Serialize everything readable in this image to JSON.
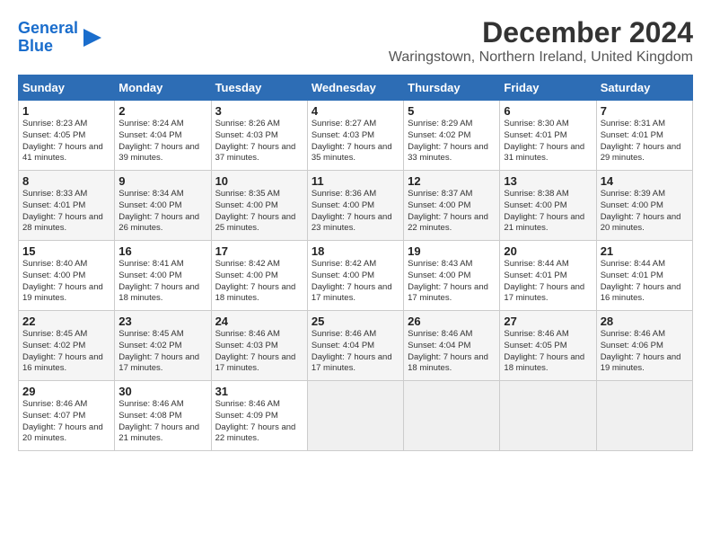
{
  "logo": {
    "line1": "General",
    "line2": "Blue"
  },
  "title": "December 2024",
  "subtitle": "Waringstown, Northern Ireland, United Kingdom",
  "days_of_week": [
    "Sunday",
    "Monday",
    "Tuesday",
    "Wednesday",
    "Thursday",
    "Friday",
    "Saturday"
  ],
  "weeks": [
    [
      {
        "day": "1",
        "info": "Sunrise: 8:23 AM\nSunset: 4:05 PM\nDaylight: 7 hours\nand 41 minutes."
      },
      {
        "day": "2",
        "info": "Sunrise: 8:24 AM\nSunset: 4:04 PM\nDaylight: 7 hours\nand 39 minutes."
      },
      {
        "day": "3",
        "info": "Sunrise: 8:26 AM\nSunset: 4:03 PM\nDaylight: 7 hours\nand 37 minutes."
      },
      {
        "day": "4",
        "info": "Sunrise: 8:27 AM\nSunset: 4:03 PM\nDaylight: 7 hours\nand 35 minutes."
      },
      {
        "day": "5",
        "info": "Sunrise: 8:29 AM\nSunset: 4:02 PM\nDaylight: 7 hours\nand 33 minutes."
      },
      {
        "day": "6",
        "info": "Sunrise: 8:30 AM\nSunset: 4:01 PM\nDaylight: 7 hours\nand 31 minutes."
      },
      {
        "day": "7",
        "info": "Sunrise: 8:31 AM\nSunset: 4:01 PM\nDaylight: 7 hours\nand 29 minutes."
      }
    ],
    [
      {
        "day": "8",
        "info": "Sunrise: 8:33 AM\nSunset: 4:01 PM\nDaylight: 7 hours\nand 28 minutes."
      },
      {
        "day": "9",
        "info": "Sunrise: 8:34 AM\nSunset: 4:00 PM\nDaylight: 7 hours\nand 26 minutes."
      },
      {
        "day": "10",
        "info": "Sunrise: 8:35 AM\nSunset: 4:00 PM\nDaylight: 7 hours\nand 25 minutes."
      },
      {
        "day": "11",
        "info": "Sunrise: 8:36 AM\nSunset: 4:00 PM\nDaylight: 7 hours\nand 23 minutes."
      },
      {
        "day": "12",
        "info": "Sunrise: 8:37 AM\nSunset: 4:00 PM\nDaylight: 7 hours\nand 22 minutes."
      },
      {
        "day": "13",
        "info": "Sunrise: 8:38 AM\nSunset: 4:00 PM\nDaylight: 7 hours\nand 21 minutes."
      },
      {
        "day": "14",
        "info": "Sunrise: 8:39 AM\nSunset: 4:00 PM\nDaylight: 7 hours\nand 20 minutes."
      }
    ],
    [
      {
        "day": "15",
        "info": "Sunrise: 8:40 AM\nSunset: 4:00 PM\nDaylight: 7 hours\nand 19 minutes."
      },
      {
        "day": "16",
        "info": "Sunrise: 8:41 AM\nSunset: 4:00 PM\nDaylight: 7 hours\nand 18 minutes."
      },
      {
        "day": "17",
        "info": "Sunrise: 8:42 AM\nSunset: 4:00 PM\nDaylight: 7 hours\nand 18 minutes."
      },
      {
        "day": "18",
        "info": "Sunrise: 8:42 AM\nSunset: 4:00 PM\nDaylight: 7 hours\nand 17 minutes."
      },
      {
        "day": "19",
        "info": "Sunrise: 8:43 AM\nSunset: 4:00 PM\nDaylight: 7 hours\nand 17 minutes."
      },
      {
        "day": "20",
        "info": "Sunrise: 8:44 AM\nSunset: 4:01 PM\nDaylight: 7 hours\nand 17 minutes."
      },
      {
        "day": "21",
        "info": "Sunrise: 8:44 AM\nSunset: 4:01 PM\nDaylight: 7 hours\nand 16 minutes."
      }
    ],
    [
      {
        "day": "22",
        "info": "Sunrise: 8:45 AM\nSunset: 4:02 PM\nDaylight: 7 hours\nand 16 minutes."
      },
      {
        "day": "23",
        "info": "Sunrise: 8:45 AM\nSunset: 4:02 PM\nDaylight: 7 hours\nand 17 minutes."
      },
      {
        "day": "24",
        "info": "Sunrise: 8:46 AM\nSunset: 4:03 PM\nDaylight: 7 hours\nand 17 minutes."
      },
      {
        "day": "25",
        "info": "Sunrise: 8:46 AM\nSunset: 4:04 PM\nDaylight: 7 hours\nand 17 minutes."
      },
      {
        "day": "26",
        "info": "Sunrise: 8:46 AM\nSunset: 4:04 PM\nDaylight: 7 hours\nand 18 minutes."
      },
      {
        "day": "27",
        "info": "Sunrise: 8:46 AM\nSunset: 4:05 PM\nDaylight: 7 hours\nand 18 minutes."
      },
      {
        "day": "28",
        "info": "Sunrise: 8:46 AM\nSunset: 4:06 PM\nDaylight: 7 hours\nand 19 minutes."
      }
    ],
    [
      {
        "day": "29",
        "info": "Sunrise: 8:46 AM\nSunset: 4:07 PM\nDaylight: 7 hours\nand 20 minutes."
      },
      {
        "day": "30",
        "info": "Sunrise: 8:46 AM\nSunset: 4:08 PM\nDaylight: 7 hours\nand 21 minutes."
      },
      {
        "day": "31",
        "info": "Sunrise: 8:46 AM\nSunset: 4:09 PM\nDaylight: 7 hours\nand 22 minutes."
      },
      null,
      null,
      null,
      null
    ]
  ]
}
